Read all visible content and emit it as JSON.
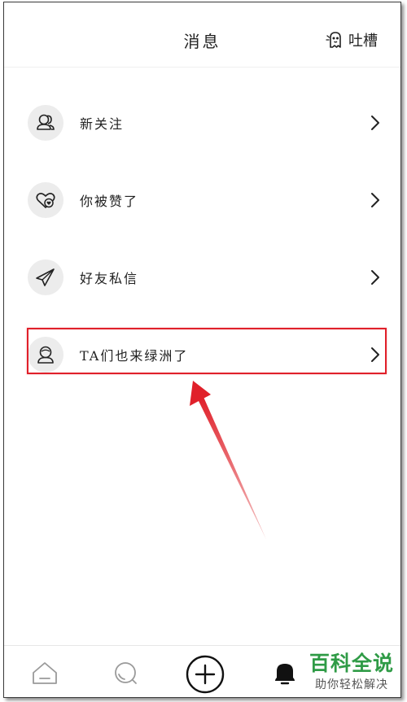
{
  "header": {
    "title": "消息",
    "feedback_label": "吐槽",
    "feedback_icon": "ghost-icon"
  },
  "list": {
    "items": [
      {
        "label": "新关注",
        "icon": "people-icon"
      },
      {
        "label": "你被赞了",
        "icon": "heart-chat-icon"
      },
      {
        "label": "好友私信",
        "icon": "paper-plane-icon"
      },
      {
        "label": "TA们也来绿洲了",
        "icon": "person-icon"
      }
    ]
  },
  "bottom_nav": {
    "tabs": [
      {
        "icon": "home-icon"
      },
      {
        "icon": "discover-icon"
      },
      {
        "icon": "add-icon"
      },
      {
        "icon": "bell-icon"
      }
    ]
  },
  "watermark": {
    "main": "百科全说",
    "sub": "助你轻松解决"
  },
  "colors": {
    "highlight": "#e0202a",
    "watermark_green": "#2f9b46",
    "icon_bg": "#ececec"
  }
}
